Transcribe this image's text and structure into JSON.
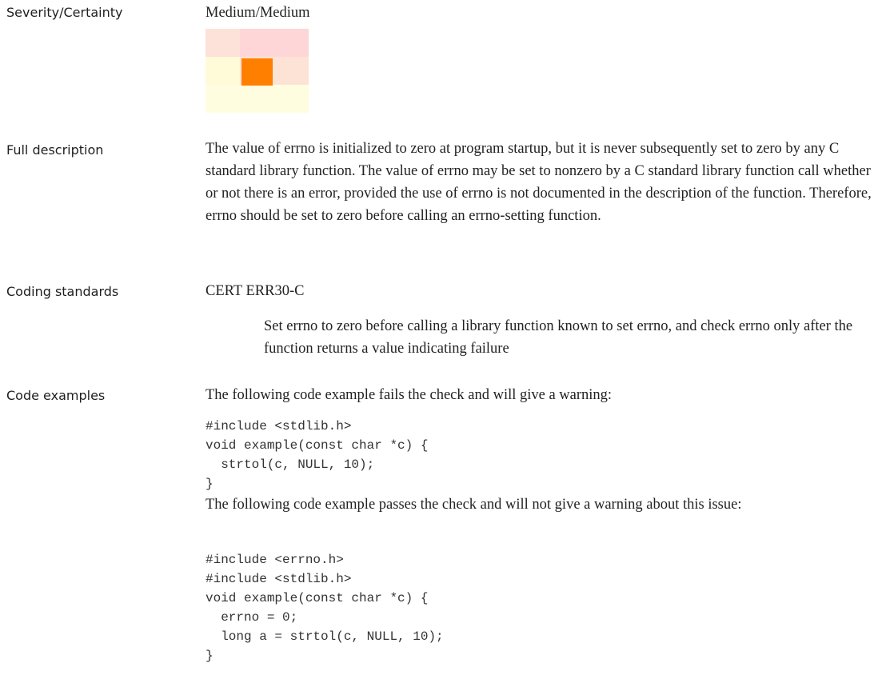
{
  "severity": {
    "label": "Severity/Certainty",
    "value": "Medium/Medium",
    "matrix": {
      "colors": [
        [
          "#fde2da",
          "#ffd6d8",
          "#ffd6d8"
        ],
        [
          "#fffad8",
          "#ff7f00",
          "#fde2d6"
        ],
        [
          "#fffde0",
          "#fffde0",
          "#fffde0"
        ]
      ],
      "selected_row": 1,
      "selected_col": 1
    }
  },
  "full_description": {
    "label": "Full description",
    "text": " The value of errno is initialized to zero at program startup, but it is never  subsequently set to zero by any C standard library function. The value of errno  may be set to nonzero by a C standard library function call whether or not there  is an error, provided the use of errno is not documented in the description of  the function. Therefore, errno should be set to zero before calling an errno-setting  function."
  },
  "coding_standards": {
    "label": "Coding standards",
    "standard": "CERT ERR30-C",
    "rule_text": "Set errno to zero before calling a library function known to set errno, and check errno only after the function returns a value indicating failure"
  },
  "code_examples": {
    "label": "Code examples",
    "fail_intro": "The following code example fails the check and will give a warning:",
    "fail_code": "#include <stdlib.h>\nvoid example(const char *c) {\n  strtol(c, NULL, 10);\n}",
    "pass_intro": "The following code example passes the check and will not give a warning about this issue:",
    "pass_code": "#include <errno.h>\n#include <stdlib.h>\nvoid example(const char *c) {\n  errno = 0;\n  long a = strtol(c, NULL, 10);\n}"
  }
}
